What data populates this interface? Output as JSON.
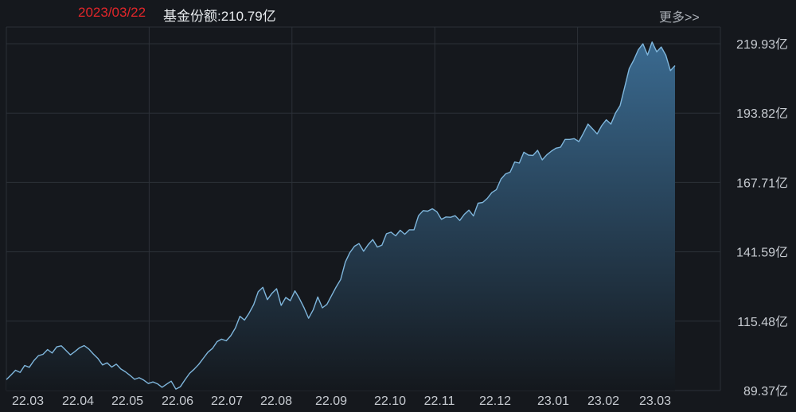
{
  "header": {
    "date": "2023/03/22",
    "share_label": "基金份额:210.79亿",
    "more_label": "更多>>"
  },
  "colors": {
    "background": "#15181d",
    "grid": "#2c3138",
    "line": "#7fb6dc",
    "area_top": "#3a6a90",
    "area_bottom": "#14181d",
    "date": "#e0262a"
  },
  "chart_data": {
    "type": "area",
    "title": "",
    "xlabel": "",
    "ylabel": "",
    "unit": "亿",
    "ylim": [
      89.37,
      219.93
    ],
    "y_ticks": [
      "219.93亿",
      "193.82亿",
      "167.71亿",
      "141.59亿",
      "115.48亿",
      "89.37亿"
    ],
    "x_ticks": [
      "22.03",
      "22.04",
      "22.05",
      "22.06",
      "22.07",
      "22.08",
      "22.09",
      "22.10",
      "22.11",
      "22.12",
      "23.01",
      "23.02",
      "23.03"
    ],
    "grid": true,
    "series": [
      {
        "values": [
          93.5,
          95.2,
          97.0,
          96.2,
          98.8,
          98.1,
          100.6,
          102.5,
          103.0,
          104.8,
          103.5,
          105.8,
          106.2,
          104.5,
          102.8,
          104.1,
          105.5,
          106.3,
          105.0,
          103.1,
          101.4,
          99.0,
          99.8,
          98.2,
          99.3,
          97.5,
          96.4,
          95.1,
          93.6,
          94.2,
          93.3,
          92.0,
          92.6,
          91.9,
          90.6,
          91.8,
          92.9,
          89.9,
          90.8,
          93.4,
          95.8,
          97.4,
          99.2,
          101.5,
          103.8,
          105.2,
          107.8,
          108.7,
          108.1,
          110.0,
          112.9,
          117.3,
          115.9,
          118.5,
          121.7,
          126.6,
          128.2,
          123.6,
          126.0,
          127.7,
          121.4,
          124.4,
          123.2,
          126.9,
          124.0,
          120.5,
          116.6,
          119.8,
          124.6,
          120.5,
          121.8,
          125.1,
          128.3,
          131.2,
          137.7,
          141.3,
          143.7,
          144.7,
          141.8,
          144.3,
          146.2,
          143.4,
          144.1,
          148.4,
          149.0,
          147.6,
          149.7,
          148.2,
          149.9,
          149.9,
          155.2,
          157.1,
          156.9,
          157.8,
          156.7,
          153.8,
          154.7,
          154.6,
          155.2,
          153.4,
          155.7,
          157.3,
          155.1,
          159.9,
          160.2,
          161.7,
          163.9,
          165.0,
          169.0,
          170.9,
          171.6,
          175.4,
          175.0,
          179.1,
          178.0,
          177.9,
          179.8,
          176.2,
          178.1,
          179.5,
          180.6,
          181.0,
          183.9,
          183.9,
          184.2,
          183.1,
          186.2,
          189.7,
          187.9,
          186.0,
          189.1,
          191.3,
          189.7,
          193.8,
          196.6,
          203.5,
          210.6,
          213.8,
          217.7,
          219.9,
          215.7,
          220.6,
          216.9,
          218.7,
          215.6,
          209.8,
          211.7
        ]
      }
    ]
  }
}
